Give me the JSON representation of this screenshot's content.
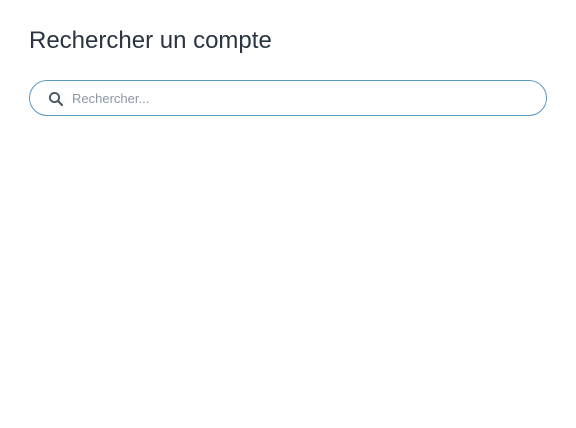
{
  "page": {
    "title": "Rechercher un compte"
  },
  "search": {
    "value": "",
    "placeholder": "Rechercher...",
    "icon": "search-icon"
  },
  "colors": {
    "title": "#2b3542",
    "input_border": "#5b97c4",
    "placeholder": "#8b96a3",
    "icon": "#4a5563"
  }
}
